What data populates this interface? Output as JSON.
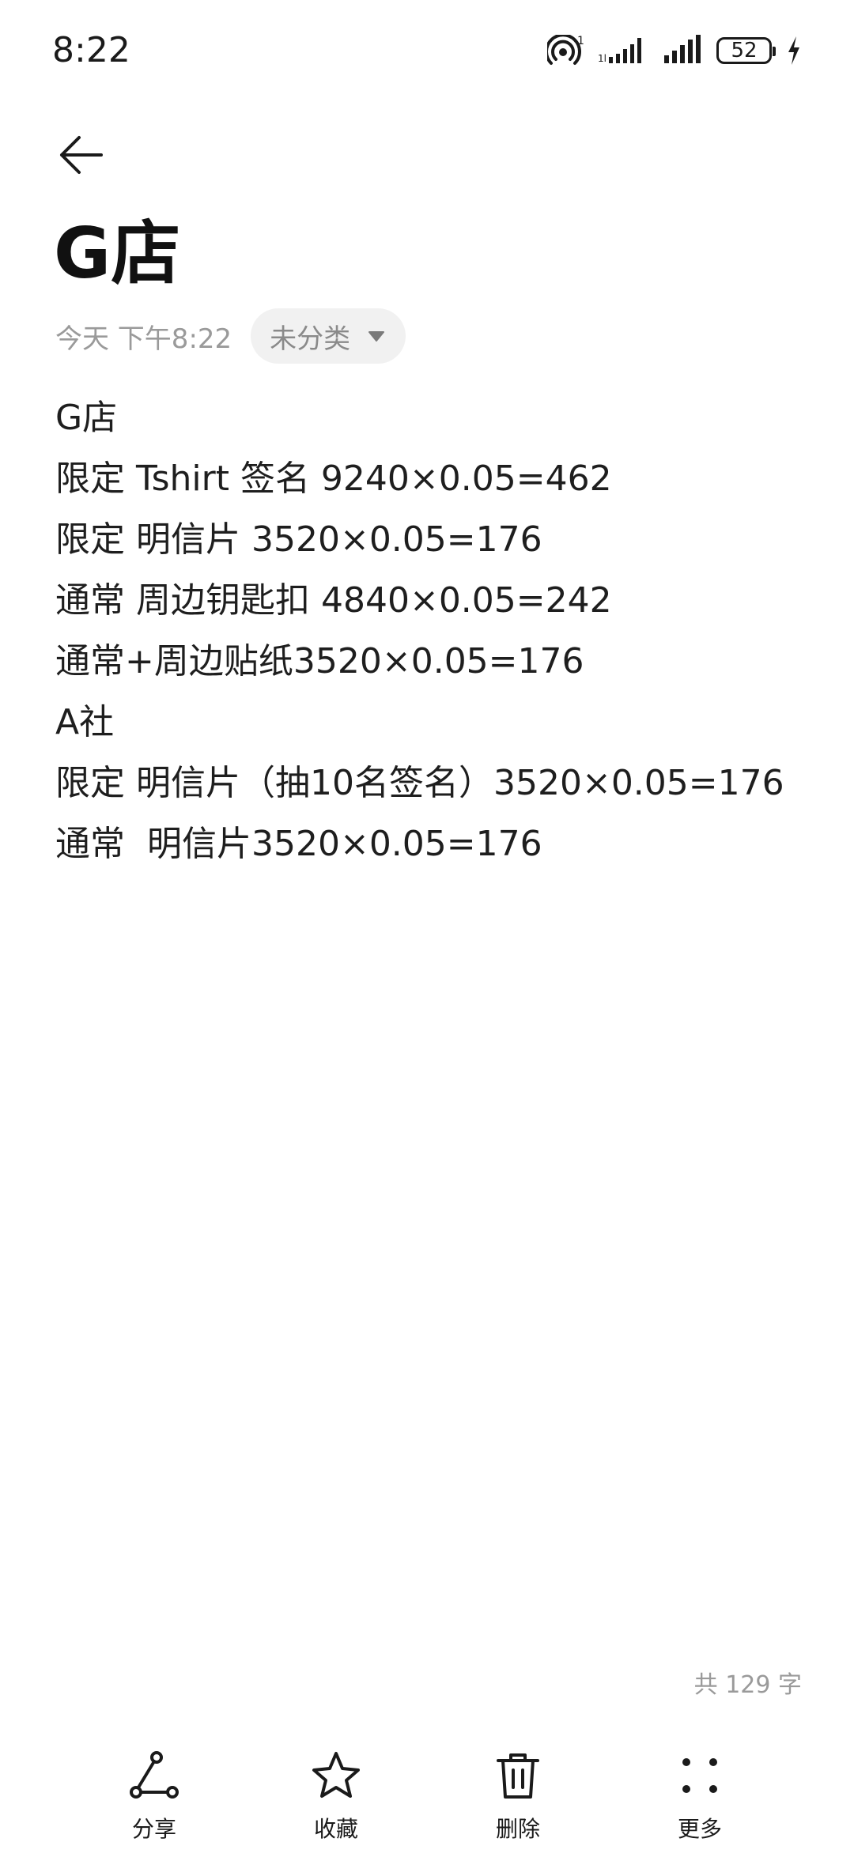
{
  "status_bar": {
    "time": "8:22",
    "battery": "52",
    "icons": [
      "hotspot-icon",
      "signal-icon",
      "signal-icon",
      "battery-icon",
      "charging-icon"
    ]
  },
  "header": {
    "back_icon": "back-arrow-icon",
    "title": "G店",
    "date": "今天 下午8:22",
    "category": "未分类"
  },
  "body": {
    "lines": [
      "G店",
      "限定 Tshirt 签名 9240×0.05=462",
      "限定 明信片 3520×0.05=176",
      "通常 周边钥匙扣 4840×0.05=242",
      "通常+周边贴纸3520×0.05=176",
      "A社",
      "限定 明信片（抽10名签名）3520×0.05=176",
      "通常  明信片3520×0.05=176"
    ]
  },
  "footer": {
    "word_count": "共 129 字"
  },
  "toolbar": {
    "items": [
      {
        "icon": "share-icon",
        "label": "分享"
      },
      {
        "icon": "star-icon",
        "label": "收藏"
      },
      {
        "icon": "trash-icon",
        "label": "删除"
      },
      {
        "icon": "more-icon",
        "label": "更多"
      }
    ]
  }
}
